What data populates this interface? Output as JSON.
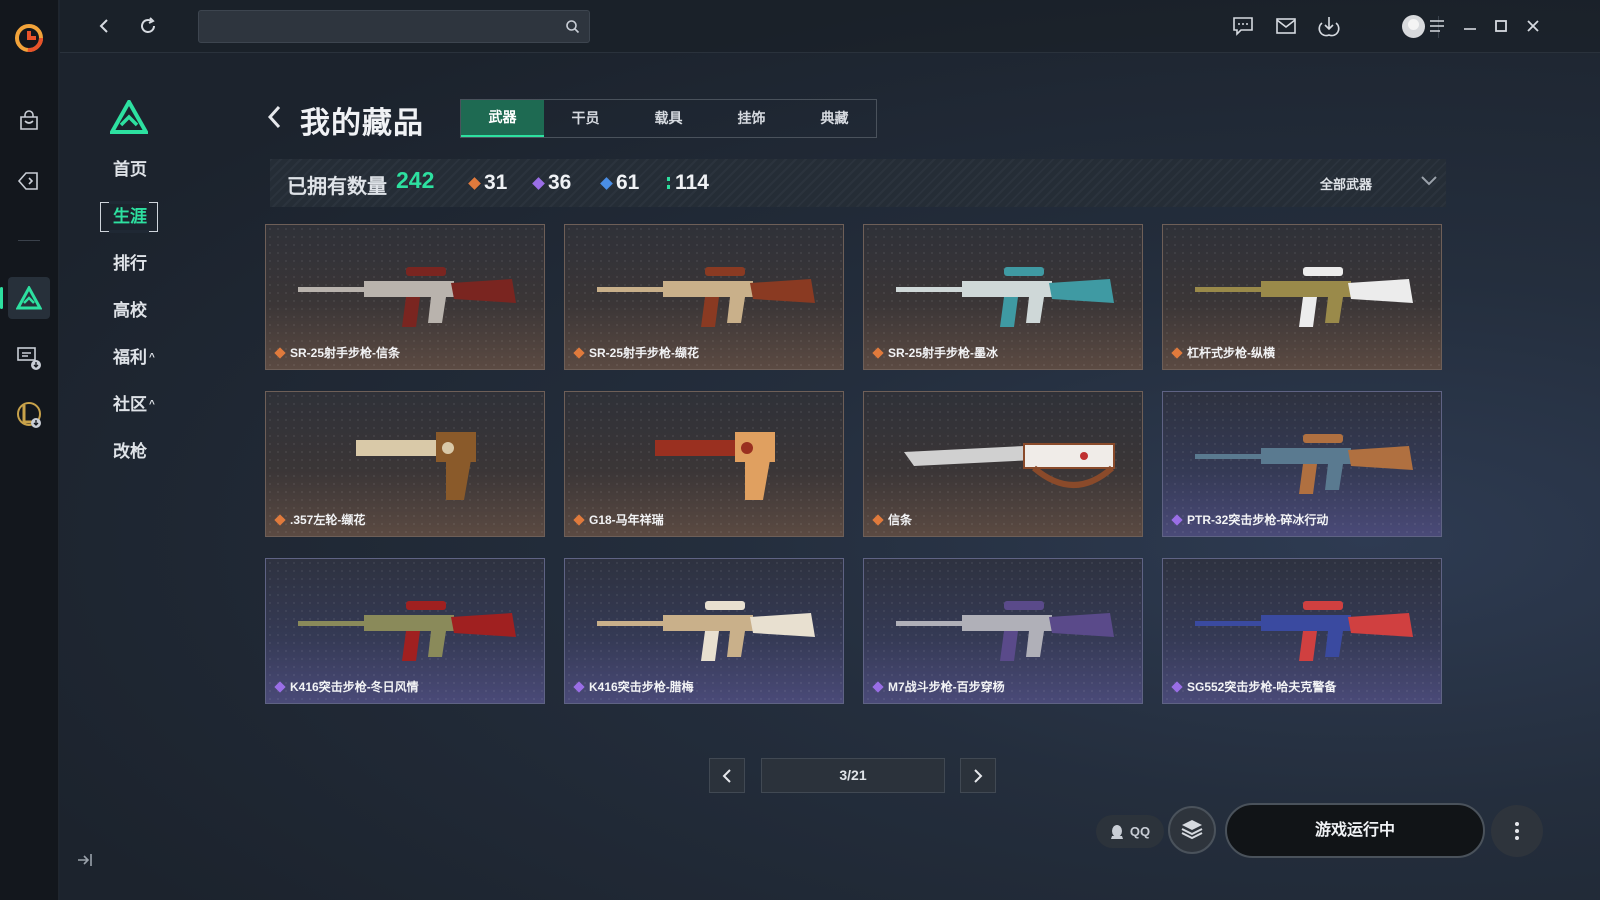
{
  "app": {
    "rail_items": [
      "logo-icon",
      "shop-bag-icon",
      "tag-icon",
      "game-triangle-icon",
      "chat-download-icon",
      "league-icon"
    ]
  },
  "topbar": {
    "search_placeholder": "",
    "icons": [
      "message-icon",
      "mail-icon",
      "download-icon",
      "avatar",
      "menu-icon",
      "minimize-icon",
      "maximize-icon",
      "close-icon"
    ]
  },
  "subnav": {
    "items": [
      {
        "label": "首页"
      },
      {
        "label": "生涯"
      },
      {
        "label": "排行"
      },
      {
        "label": "高校"
      },
      {
        "label": "福利"
      },
      {
        "label": "社区"
      },
      {
        "label": "改枪"
      }
    ],
    "active_index": 1
  },
  "page": {
    "title": "我的藏品",
    "tabs": [
      "武器",
      "干员",
      "载具",
      "挂饰",
      "典藏"
    ],
    "active_tab": 0
  },
  "stats": {
    "owned_label": "已拥有数量",
    "owned_count": "242",
    "tiers": [
      {
        "color": "#e07a3c",
        "count": "31"
      },
      {
        "color": "#9a6ee6",
        "count": "36"
      },
      {
        "color": "#4a8ee6",
        "count": "61"
      },
      {
        "color": "#2de0a0",
        "count": "114"
      }
    ],
    "filter_label": "全部武器"
  },
  "items": [
    {
      "name": "SR-25射手步枪-信条",
      "rarity": "orange",
      "rarity_color": "#e07a3c"
    },
    {
      "name": "SR-25射手步枪-缬花",
      "rarity": "orange",
      "rarity_color": "#e07a3c"
    },
    {
      "name": "SR-25射手步枪-墨冰",
      "rarity": "orange",
      "rarity_color": "#e07a3c"
    },
    {
      "name": "杠杆式步枪-纵横",
      "rarity": "orange",
      "rarity_color": "#e07a3c"
    },
    {
      "name": ".357左轮-缬花",
      "rarity": "orange",
      "rarity_color": "#e07a3c"
    },
    {
      "name": "G18-马年祥瑞",
      "rarity": "orange",
      "rarity_color": "#e07a3c"
    },
    {
      "name": "信条",
      "rarity": "orange",
      "rarity_color": "#e07a3c"
    },
    {
      "name": "PTR-32突击步枪-碎冰行动",
      "rarity": "purple",
      "rarity_color": "#9a6ee6"
    },
    {
      "name": "K416突击步枪-冬日风情",
      "rarity": "purple",
      "rarity_color": "#9a6ee6"
    },
    {
      "name": "K416突击步枪-腊梅",
      "rarity": "purple",
      "rarity_color": "#9a6ee6"
    },
    {
      "name": "M7战斗步枪-百步穿杨",
      "rarity": "purple",
      "rarity_color": "#9a6ee6"
    },
    {
      "name": "SG552突击步枪-哈夫克警备",
      "rarity": "purple",
      "rarity_color": "#9a6ee6"
    }
  ],
  "pagination": {
    "current": 3,
    "total": 21,
    "text": "3/21"
  },
  "footer": {
    "qq_label": "QQ",
    "run_label": "游戏运行中"
  },
  "colors": {
    "accent": "#2de0a0"
  }
}
